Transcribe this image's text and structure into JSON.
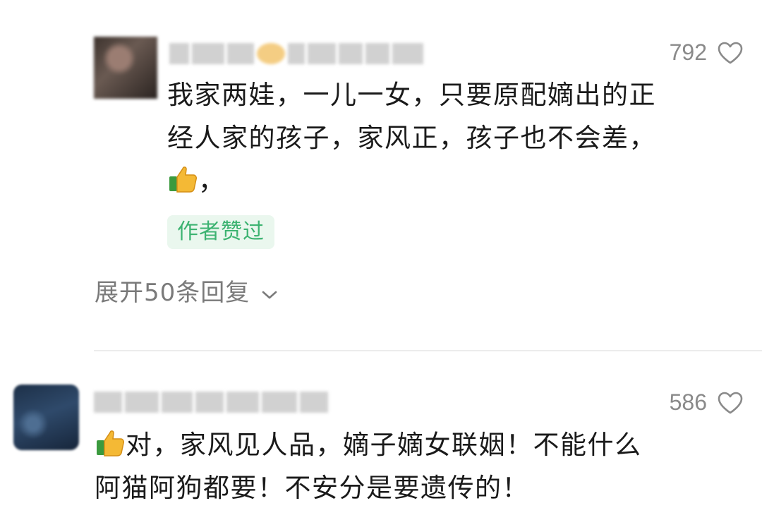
{
  "comments": [
    {
      "likes": "792",
      "lines": [
        "我家两娃，一儿一女，只要原配嫡出的正",
        "经人家的孩子，家风正，孩子也不会差，",
        "，"
      ],
      "badge": "作者赞过",
      "replies_label": "展开50条回复"
    },
    {
      "likes": "586",
      "lines": [
        "对，家风见人品，嫡子嫡女联姻！不能什么",
        "阿猫阿狗都要！不安分是要遗传的！"
      ]
    }
  ],
  "icons": {
    "like": "heart-outline-icon",
    "emoji": "thumbs-up-icon",
    "expand": "chevron-down-icon"
  },
  "colors": {
    "badge_text": "#3cb371",
    "badge_bg": "#eaf7ee",
    "secondary_text": "#8a8a8a"
  }
}
